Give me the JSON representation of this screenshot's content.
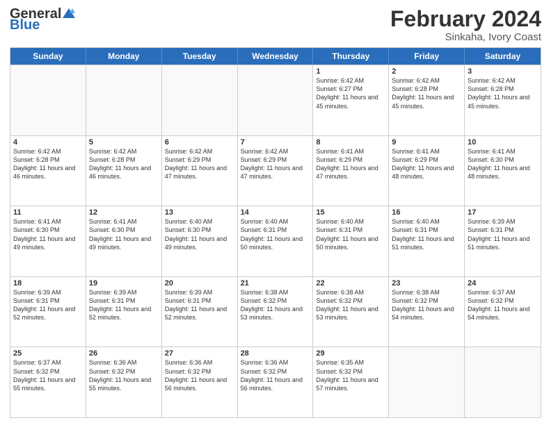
{
  "header": {
    "logo": {
      "general": "General",
      "blue": "Blue"
    },
    "title": "February 2024",
    "location": "Sinkaha, Ivory Coast"
  },
  "days_of_week": [
    "Sunday",
    "Monday",
    "Tuesday",
    "Wednesday",
    "Thursday",
    "Friday",
    "Saturday"
  ],
  "rows": [
    [
      {
        "day": "",
        "info": ""
      },
      {
        "day": "",
        "info": ""
      },
      {
        "day": "",
        "info": ""
      },
      {
        "day": "",
        "info": ""
      },
      {
        "day": "1",
        "info": "Sunrise: 6:42 AM\nSunset: 6:27 PM\nDaylight: 11 hours and 45 minutes."
      },
      {
        "day": "2",
        "info": "Sunrise: 6:42 AM\nSunset: 6:28 PM\nDaylight: 11 hours and 45 minutes."
      },
      {
        "day": "3",
        "info": "Sunrise: 6:42 AM\nSunset: 6:28 PM\nDaylight: 11 hours and 45 minutes."
      }
    ],
    [
      {
        "day": "4",
        "info": "Sunrise: 6:42 AM\nSunset: 6:28 PM\nDaylight: 11 hours and 46 minutes."
      },
      {
        "day": "5",
        "info": "Sunrise: 6:42 AM\nSunset: 6:28 PM\nDaylight: 11 hours and 46 minutes."
      },
      {
        "day": "6",
        "info": "Sunrise: 6:42 AM\nSunset: 6:29 PM\nDaylight: 11 hours and 47 minutes."
      },
      {
        "day": "7",
        "info": "Sunrise: 6:42 AM\nSunset: 6:29 PM\nDaylight: 11 hours and 47 minutes."
      },
      {
        "day": "8",
        "info": "Sunrise: 6:41 AM\nSunset: 6:29 PM\nDaylight: 11 hours and 47 minutes."
      },
      {
        "day": "9",
        "info": "Sunrise: 6:41 AM\nSunset: 6:29 PM\nDaylight: 11 hours and 48 minutes."
      },
      {
        "day": "10",
        "info": "Sunrise: 6:41 AM\nSunset: 6:30 PM\nDaylight: 11 hours and 48 minutes."
      }
    ],
    [
      {
        "day": "11",
        "info": "Sunrise: 6:41 AM\nSunset: 6:30 PM\nDaylight: 11 hours and 49 minutes."
      },
      {
        "day": "12",
        "info": "Sunrise: 6:41 AM\nSunset: 6:30 PM\nDaylight: 11 hours and 49 minutes."
      },
      {
        "day": "13",
        "info": "Sunrise: 6:40 AM\nSunset: 6:30 PM\nDaylight: 11 hours and 49 minutes."
      },
      {
        "day": "14",
        "info": "Sunrise: 6:40 AM\nSunset: 6:31 PM\nDaylight: 11 hours and 50 minutes."
      },
      {
        "day": "15",
        "info": "Sunrise: 6:40 AM\nSunset: 6:31 PM\nDaylight: 11 hours and 50 minutes."
      },
      {
        "day": "16",
        "info": "Sunrise: 6:40 AM\nSunset: 6:31 PM\nDaylight: 11 hours and 51 minutes."
      },
      {
        "day": "17",
        "info": "Sunrise: 6:39 AM\nSunset: 6:31 PM\nDaylight: 11 hours and 51 minutes."
      }
    ],
    [
      {
        "day": "18",
        "info": "Sunrise: 6:39 AM\nSunset: 6:31 PM\nDaylight: 11 hours and 52 minutes."
      },
      {
        "day": "19",
        "info": "Sunrise: 6:39 AM\nSunset: 6:31 PM\nDaylight: 11 hours and 52 minutes."
      },
      {
        "day": "20",
        "info": "Sunrise: 6:39 AM\nSunset: 6:31 PM\nDaylight: 11 hours and 52 minutes."
      },
      {
        "day": "21",
        "info": "Sunrise: 6:38 AM\nSunset: 6:32 PM\nDaylight: 11 hours and 53 minutes."
      },
      {
        "day": "22",
        "info": "Sunrise: 6:38 AM\nSunset: 6:32 PM\nDaylight: 11 hours and 53 minutes."
      },
      {
        "day": "23",
        "info": "Sunrise: 6:38 AM\nSunset: 6:32 PM\nDaylight: 11 hours and 54 minutes."
      },
      {
        "day": "24",
        "info": "Sunrise: 6:37 AM\nSunset: 6:32 PM\nDaylight: 11 hours and 54 minutes."
      }
    ],
    [
      {
        "day": "25",
        "info": "Sunrise: 6:37 AM\nSunset: 6:32 PM\nDaylight: 11 hours and 55 minutes."
      },
      {
        "day": "26",
        "info": "Sunrise: 6:36 AM\nSunset: 6:32 PM\nDaylight: 11 hours and 55 minutes."
      },
      {
        "day": "27",
        "info": "Sunrise: 6:36 AM\nSunset: 6:32 PM\nDaylight: 11 hours and 56 minutes."
      },
      {
        "day": "28",
        "info": "Sunrise: 6:36 AM\nSunset: 6:32 PM\nDaylight: 11 hours and 56 minutes."
      },
      {
        "day": "29",
        "info": "Sunrise: 6:35 AM\nSunset: 6:32 PM\nDaylight: 11 hours and 57 minutes."
      },
      {
        "day": "",
        "info": ""
      },
      {
        "day": "",
        "info": ""
      }
    ]
  ]
}
